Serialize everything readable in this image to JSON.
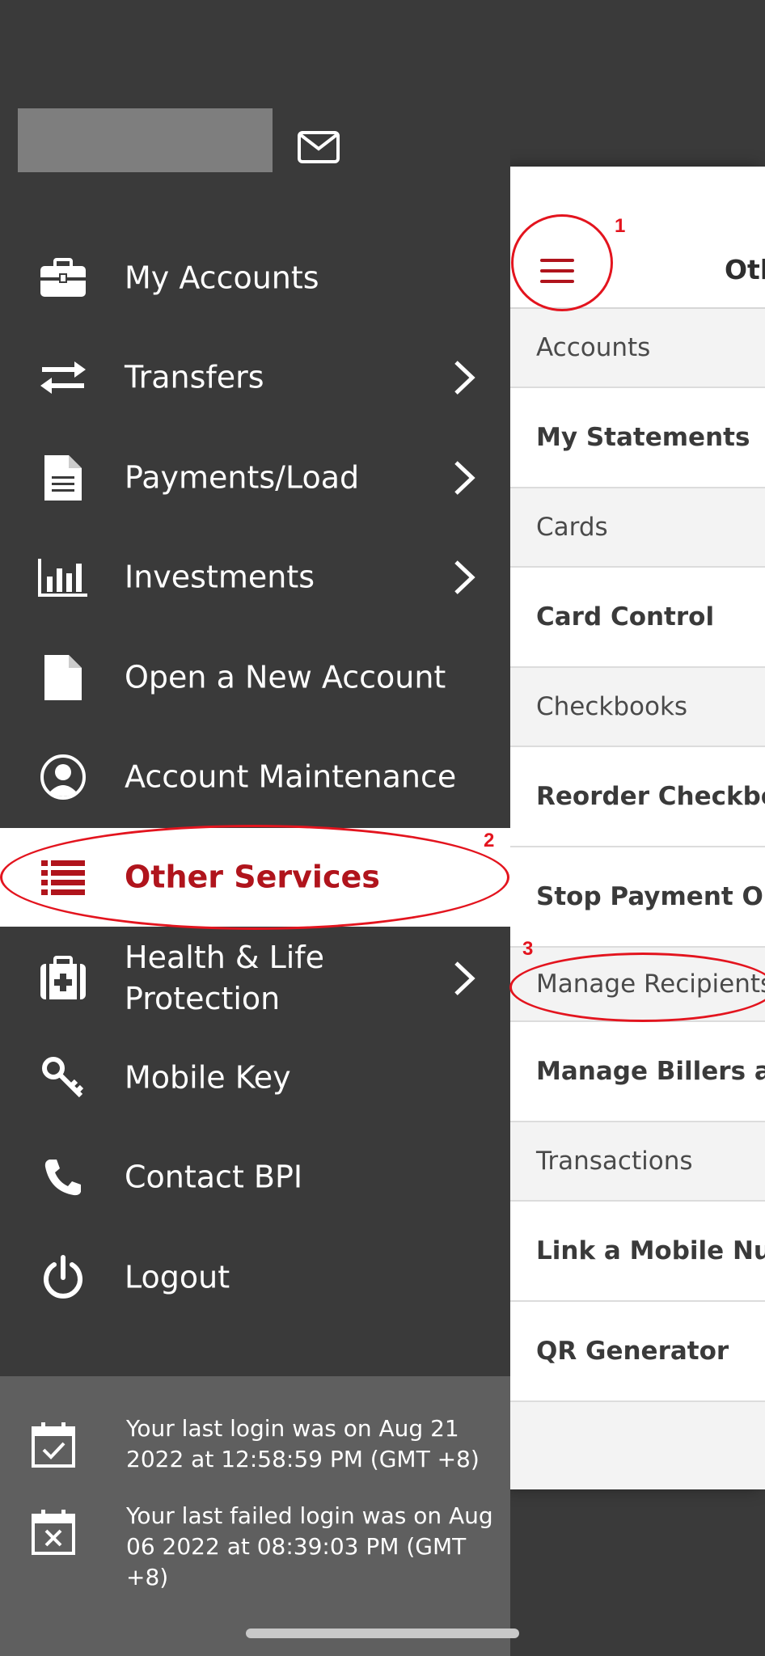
{
  "drawer": {
    "menu": [
      {
        "label": "My Accounts",
        "icon": "briefcase-icon",
        "chevron": false
      },
      {
        "label": "Transfers",
        "icon": "transfer-arrows-icon",
        "chevron": true
      },
      {
        "label": "Payments/Load",
        "icon": "document-icon",
        "chevron": true
      },
      {
        "label": "Investments",
        "icon": "bar-chart-icon",
        "chevron": true
      },
      {
        "label": "Open a New Account",
        "icon": "blank-page-icon",
        "chevron": false
      },
      {
        "label": "Account Maintenance",
        "icon": "user-circle-icon",
        "chevron": false
      },
      {
        "label": "Other Services",
        "icon": "list-icon",
        "chevron": false,
        "active": true
      },
      {
        "label": "Health & Life Protection",
        "icon": "medical-kit-icon",
        "chevron": true
      },
      {
        "label": "Mobile Key",
        "icon": "key-icon",
        "chevron": false
      },
      {
        "label": "Contact BPI",
        "icon": "phone-icon",
        "chevron": false
      },
      {
        "label": "Logout",
        "icon": "power-icon",
        "chevron": false
      }
    ],
    "footer": {
      "last_login": "Your last login was on Aug 21 2022 at 12:58:59 PM (GMT +8)",
      "last_failed_login": "Your last failed login was on Aug 06 2022 at 08:39:03 PM (GMT +8)"
    }
  },
  "panel": {
    "title": "Oth",
    "rows": [
      {
        "type": "section",
        "label": "Accounts"
      },
      {
        "type": "item",
        "label": "My Statements"
      },
      {
        "type": "section",
        "label": "Cards"
      },
      {
        "type": "item",
        "label": "Card Control"
      },
      {
        "type": "section",
        "label": "Checkbooks"
      },
      {
        "type": "item",
        "label": "Reorder Checkbook"
      },
      {
        "type": "item",
        "label": "Stop Payment Orde"
      },
      {
        "type": "section",
        "label": "Manage Recipients"
      },
      {
        "type": "item",
        "label": "Manage Billers and"
      },
      {
        "type": "section",
        "label": "Transactions"
      },
      {
        "type": "item",
        "label": "Link a Mobile Numl"
      },
      {
        "type": "item",
        "label": "QR Generator"
      }
    ]
  },
  "annotations": {
    "step1": "1",
    "step2": "2",
    "step3": "3",
    "color": "#e3141e"
  },
  "colors": {
    "brand_red": "#b0141c",
    "drawer_bg": "#3a3a3a",
    "footer_bg": "#5f5f5f"
  }
}
